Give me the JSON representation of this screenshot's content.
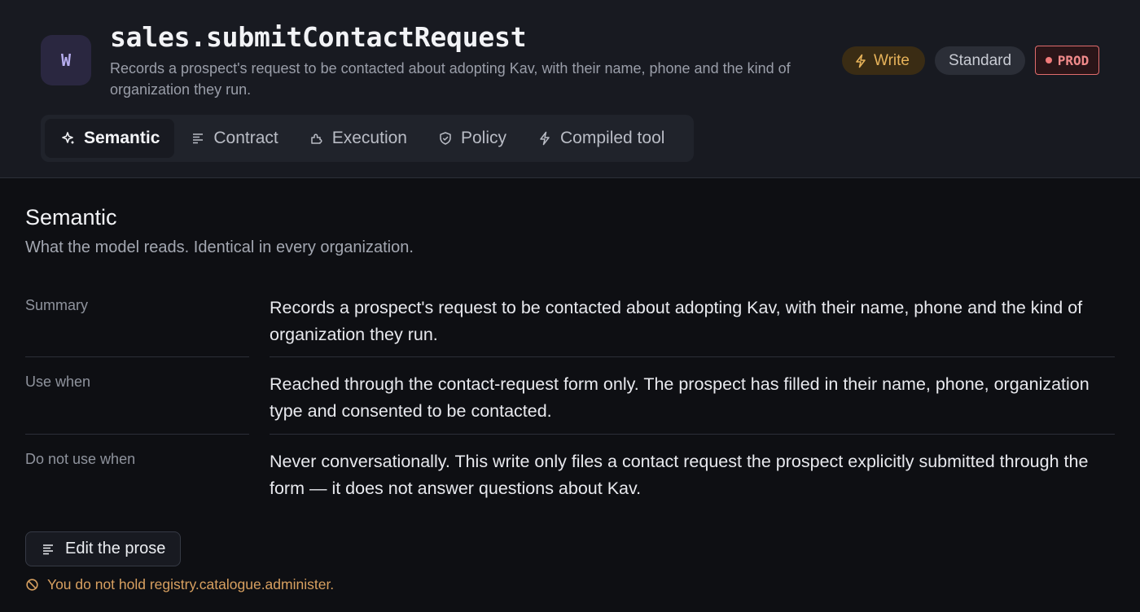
{
  "header": {
    "avatar_letter": "W",
    "title": "sales.submitContactRequest",
    "subtitle": "Records a prospect's request to be contacted about adopting Kav, with their name, phone and the kind of organization they run.",
    "badges": {
      "write": "Write",
      "standard": "Standard",
      "prod": "PROD"
    }
  },
  "tabs": [
    {
      "label": "Semantic",
      "icon": "sparkle-icon",
      "active": true
    },
    {
      "label": "Contract",
      "icon": "lines-icon",
      "active": false
    },
    {
      "label": "Execution",
      "icon": "puzzle-icon",
      "active": false
    },
    {
      "label": "Policy",
      "icon": "shield-icon",
      "active": false
    },
    {
      "label": "Compiled tool",
      "icon": "bolt-icon",
      "active": false
    }
  ],
  "section": {
    "title": "Semantic",
    "subtitle": "What the model reads. Identical in every organization."
  },
  "rows": [
    {
      "label": "Summary",
      "value": "Records a prospect's request to be contacted about adopting Kav, with their name, phone and the kind of organization they run."
    },
    {
      "label": "Use when",
      "value": "Reached through the contact-request form only. The prospect has filled in their name, phone, organization type and consented to be contacted."
    },
    {
      "label": "Do not use when",
      "value": "Never conversationally. This write only files a contact request the prospect explicitly submitted through the form — it does not answer questions about Kav."
    }
  ],
  "actions": {
    "edit_label": "Edit the prose",
    "permission_warning": "You do not hold registry.catalogue.administer."
  },
  "colors": {
    "accent_write": "#e7b35a",
    "prod": "#f08a8a",
    "warning": "#d8a060"
  }
}
